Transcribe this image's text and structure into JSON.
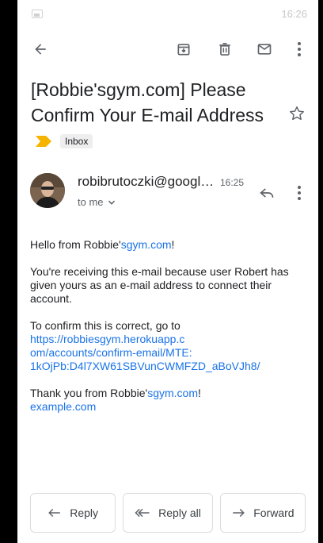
{
  "status_bar": {
    "time": "16:26"
  },
  "email": {
    "subject": "[Robbie'sgym.com] Please Confirm Your E-mail Address",
    "label": "Inbox",
    "sender": "robibrutoczki@googl…",
    "time": "16:25",
    "to": "to me",
    "body": {
      "greeting_prefix": "Hello from Robbie'",
      "greeting_link": "sgym.com",
      "greeting_suffix": "!",
      "paragraph2": "You're receiving this e-mail because user Robert has given yours as an e-mail address to connect their account.",
      "paragraph3_intro": "To confirm this is correct, go to",
      "confirm_url_lines": [
        "https://robbiesgym.herokuapp.c",
        "om/accounts/confirm-email/MTE:",
        "1kOjPb:D4l7XW61SBVunCWMFZD_aBoVJh8/"
      ],
      "thanks_prefix": "Thank you from Robbie'",
      "thanks_link": "sgym.com",
      "thanks_suffix": "!",
      "footer_link": "example.com"
    }
  },
  "actions": {
    "reply": "Reply",
    "reply_all": "Reply all",
    "forward": "Forward"
  },
  "colors": {
    "link": "#1a73e8",
    "importance_marker": "#f6b400",
    "icon": "#5f6368"
  },
  "icons": [
    "back-arrow-icon",
    "archive-icon",
    "delete-icon",
    "mail-icon",
    "more-vert-icon",
    "star-icon",
    "importance-marker-icon",
    "reply-icon",
    "reply-all-icon",
    "forward-icon",
    "chevron-down-icon"
  ]
}
